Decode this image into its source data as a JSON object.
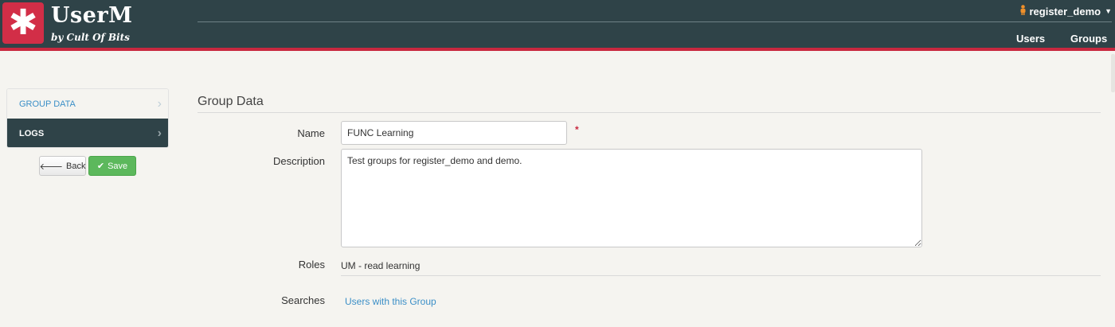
{
  "brand": {
    "logo_glyph": "✱",
    "title": "UserM",
    "subtitle": "by Cult Of Bits"
  },
  "header": {
    "user_menu": {
      "icon": "person-icon",
      "username": "register_demo"
    },
    "nav": [
      {
        "label": "Users"
      },
      {
        "label": "Groups"
      }
    ]
  },
  "sidebar": {
    "items": [
      {
        "label": "GROUP DATA",
        "active": false
      },
      {
        "label": "LOGS",
        "active": true
      }
    ],
    "buttons": {
      "back_label": "Back",
      "save_label": "Save"
    }
  },
  "form": {
    "section_title": "Group Data",
    "name": {
      "label": "Name",
      "value": "FUNC Learning",
      "required_marker": "*"
    },
    "description": {
      "label": "Description",
      "value": "Test groups for register_demo and demo."
    },
    "roles": {
      "label": "Roles",
      "value": "UM - read learning"
    },
    "searches": {
      "label": "Searches",
      "link": "Users with this Group"
    }
  },
  "colors": {
    "header_bg": "#2f4348",
    "accent": "#c8283f",
    "link": "#3b8fc7",
    "save_button": "#5cb85c"
  }
}
